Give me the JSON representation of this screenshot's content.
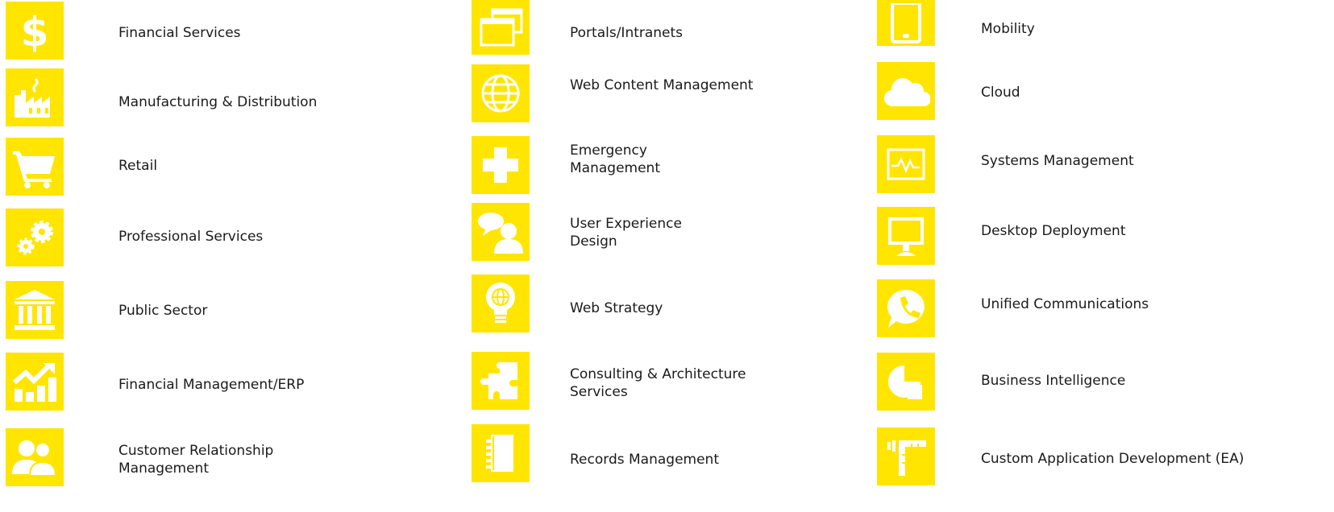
{
  "tile_color": "#FFE500",
  "columns": [
    {
      "items": [
        {
          "icon": "dollar-icon",
          "label": "Financial Services"
        },
        {
          "icon": "factory-icon",
          "label": "Manufacturing & Distribution"
        },
        {
          "icon": "shopping-cart-icon",
          "label": "Retail"
        },
        {
          "icon": "gears-icon",
          "label": "Professional Services"
        },
        {
          "icon": "government-building-icon",
          "label": "Public Sector"
        },
        {
          "icon": "growth-chart-icon",
          "label": "Financial Management/ERP"
        },
        {
          "icon": "users-icon",
          "label": "Customer Relationship Management"
        }
      ]
    },
    {
      "items": [
        {
          "icon": "windows-icon",
          "label": "Portals/Intranets"
        },
        {
          "icon": "globe-icon",
          "label": "Web Content Management"
        },
        {
          "icon": "medical-cross-icon",
          "label": "Emergency Management"
        },
        {
          "icon": "user-chat-icon",
          "label": "User Experience Design"
        },
        {
          "icon": "lightbulb-globe-icon",
          "label": "Web Strategy"
        },
        {
          "icon": "puzzle-icon",
          "label": "Consulting & Architecture Services"
        },
        {
          "icon": "notebook-icon",
          "label": "Records Management"
        }
      ]
    },
    {
      "items": [
        {
          "icon": "tablet-icon",
          "label": "Mobility"
        },
        {
          "icon": "cloud-icon",
          "label": "Cloud"
        },
        {
          "icon": "pulse-monitor-icon",
          "label": "Systems Management"
        },
        {
          "icon": "desktop-monitor-icon",
          "label": "Desktop Deployment"
        },
        {
          "icon": "phone-bubble-icon",
          "label": "Unified Communications"
        },
        {
          "icon": "pie-chart-icon",
          "label": "Business Intelligence"
        },
        {
          "icon": "ruler-icon",
          "label": "Custom Application Development (EA)"
        }
      ]
    }
  ]
}
